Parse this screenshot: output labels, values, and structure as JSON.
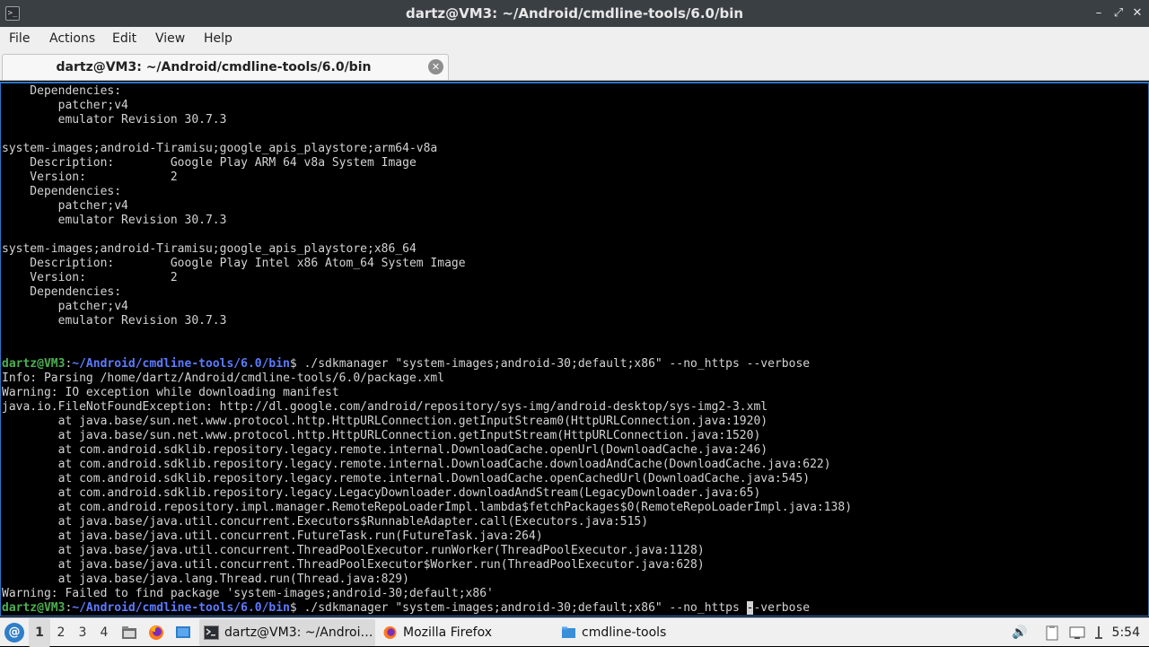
{
  "window": {
    "title": "dartz@VM3: ~/Android/cmdline-tools/6.0/bin",
    "controls": {
      "minimize": "–",
      "maximize": "⤢",
      "close": "✕"
    }
  },
  "menu": [
    "File",
    "Actions",
    "Edit",
    "View",
    "Help"
  ],
  "tab": {
    "label": "dartz@VM3: ~/Android/cmdline-tools/6.0/bin",
    "close": "✕"
  },
  "terminal": {
    "prompt_user": "dartz@VM3",
    "prompt_path": "~/Android/cmdline-tools/6.0/bin",
    "lines": [
      "    Dependencies:",
      "        patcher;v4",
      "        emulator Revision 30.7.3",
      "",
      "system-images;android-Tiramisu;google_apis_playstore;arm64-v8a",
      "    Description:        Google Play ARM 64 v8a System Image",
      "    Version:            2",
      "    Dependencies:",
      "        patcher;v4",
      "        emulator Revision 30.7.3",
      "",
      "system-images;android-Tiramisu;google_apis_playstore;x86_64",
      "    Description:        Google Play Intel x86 Atom_64 System Image",
      "    Version:            2",
      "    Dependencies:",
      "        patcher;v4",
      "        emulator Revision 30.7.3",
      "",
      "",
      "__PROMPT__$ ./sdkmanager \"system-images;android-30;default;x86\" --no_https --verbose",
      "Info: Parsing /home/dartz/Android/cmdline-tools/6.0/package.xml",
      "Warning: IO exception while downloading manifest",
      "java.io.FileNotFoundException: http://dl.google.com/android/repository/sys-img/android-desktop/sys-img2-3.xml",
      "        at java.base/sun.net.www.protocol.http.HttpURLConnection.getInputStream0(HttpURLConnection.java:1920)",
      "        at java.base/sun.net.www.protocol.http.HttpURLConnection.getInputStream(HttpURLConnection.java:1520)",
      "        at com.android.sdklib.repository.legacy.remote.internal.DownloadCache.openUrl(DownloadCache.java:246)",
      "        at com.android.sdklib.repository.legacy.remote.internal.DownloadCache.downloadAndCache(DownloadCache.java:622)",
      "        at com.android.sdklib.repository.legacy.remote.internal.DownloadCache.openCachedUrl(DownloadCache.java:545)",
      "        at com.android.sdklib.repository.legacy.LegacyDownloader.downloadAndStream(LegacyDownloader.java:65)",
      "        at com.android.repository.impl.manager.RemoteRepoLoaderImpl.lambda$fetchPackages$0(RemoteRepoLoaderImpl.java:138)",
      "        at java.base/java.util.concurrent.Executors$RunnableAdapter.call(Executors.java:515)",
      "        at java.base/java.util.concurrent.FutureTask.run(FutureTask.java:264)",
      "        at java.base/java.util.concurrent.ThreadPoolExecutor.runWorker(ThreadPoolExecutor.java:1128)",
      "        at java.base/java.util.concurrent.ThreadPoolExecutor$Worker.run(ThreadPoolExecutor.java:628)",
      "        at java.base/java.lang.Thread.run(Thread.java:829)",
      "Warning: Failed to find package 'system-images;android-30;default;x86'"
    ],
    "current_input_before_cursor": "$ ./sdkmanager \"system-images;android-30;default;x86\" --no_https ",
    "current_input_cursor_char": "-",
    "current_input_after_cursor": "-verbose"
  },
  "taskbar": {
    "start_icon": "debian-swirl-icon",
    "workspaces": [
      "1",
      "2",
      "3",
      "4"
    ],
    "active_workspace": "1",
    "tasks": [
      {
        "label": "dartz@VM3: ~/Androi…",
        "icon": "terminal-icon",
        "active": true
      },
      {
        "label": "Mozilla Firefox",
        "icon": "firefox-icon",
        "active": false
      },
      {
        "label": "cmdline-tools",
        "icon": "folder-icon",
        "active": false
      }
    ],
    "clock": "5:54"
  }
}
